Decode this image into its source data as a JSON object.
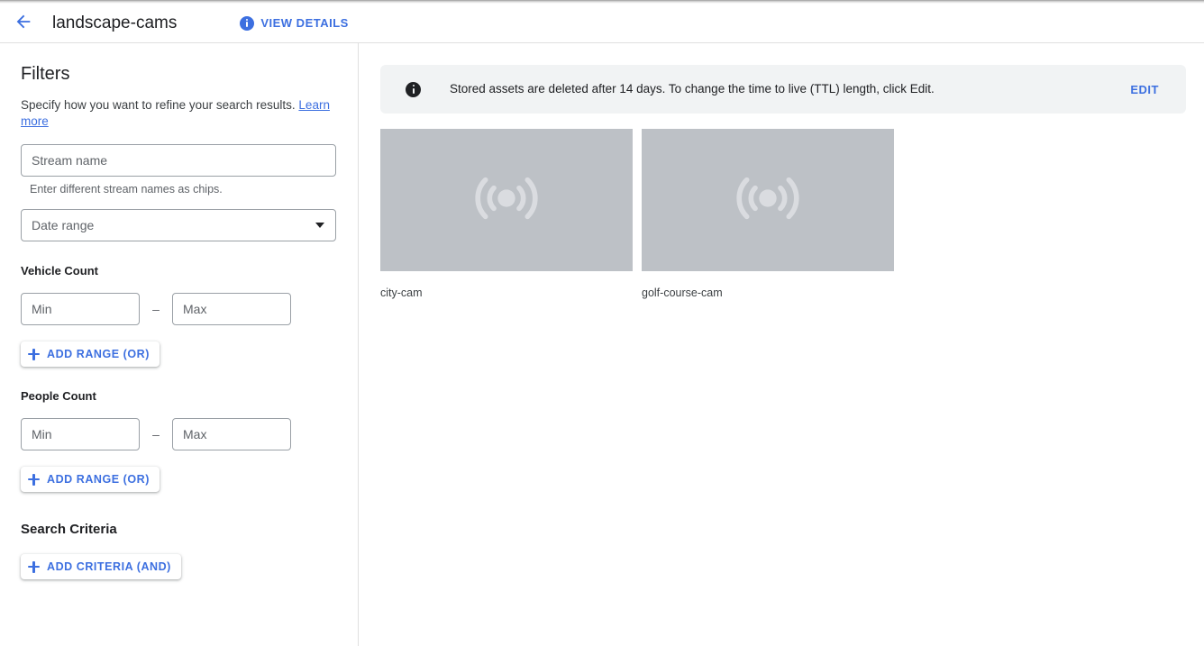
{
  "header": {
    "back_icon": "arrow-back-icon",
    "title": "landscape-cams",
    "view_details_label": "VIEW DETAILS",
    "view_details_icon": "info-icon"
  },
  "sidebar": {
    "title": "Filters",
    "subtitle": "Specify how you want to refine your search results.",
    "learn_more_label": "Learn more",
    "stream_name": {
      "placeholder": "Stream name",
      "value": "",
      "hint": "Enter different stream names as chips."
    },
    "date_range": {
      "placeholder": "Date range",
      "value": "",
      "caret_icon": "chevron-down-icon"
    },
    "vehicle_count": {
      "label": "Vehicle Count",
      "min_placeholder": "Min",
      "min_value": "",
      "max_placeholder": "Max",
      "max_value": "",
      "separator": "–",
      "add_range_label": "ADD RANGE (OR)"
    },
    "people_count": {
      "label": "People Count",
      "min_placeholder": "Min",
      "min_value": "",
      "max_placeholder": "Max",
      "max_value": "",
      "separator": "–",
      "add_range_label": "ADD RANGE (OR)"
    },
    "search_criteria": {
      "label": "Search Criteria",
      "add_criteria_label": "ADD CRITERIA (AND)"
    }
  },
  "main": {
    "banner": {
      "icon": "info-icon",
      "message": "Stored assets are deleted after 14 days. To change the time to live (TTL) length, click Edit.",
      "action_label": "EDIT"
    },
    "streams": [
      {
        "name": "city-cam",
        "thumb_icon": "broadcast-stream-icon"
      },
      {
        "name": "golf-course-cam",
        "thumb_icon": "broadcast-stream-icon"
      }
    ]
  },
  "colors": {
    "accent_blue": "#3c6fe0",
    "banner_bg": "#f1f3f4",
    "thumb_placeholder": "#bdc1c6",
    "text_primary": "#202124",
    "text_secondary": "#5f6368",
    "border": "#9aa0a6",
    "divider": "#e0e0e0"
  }
}
